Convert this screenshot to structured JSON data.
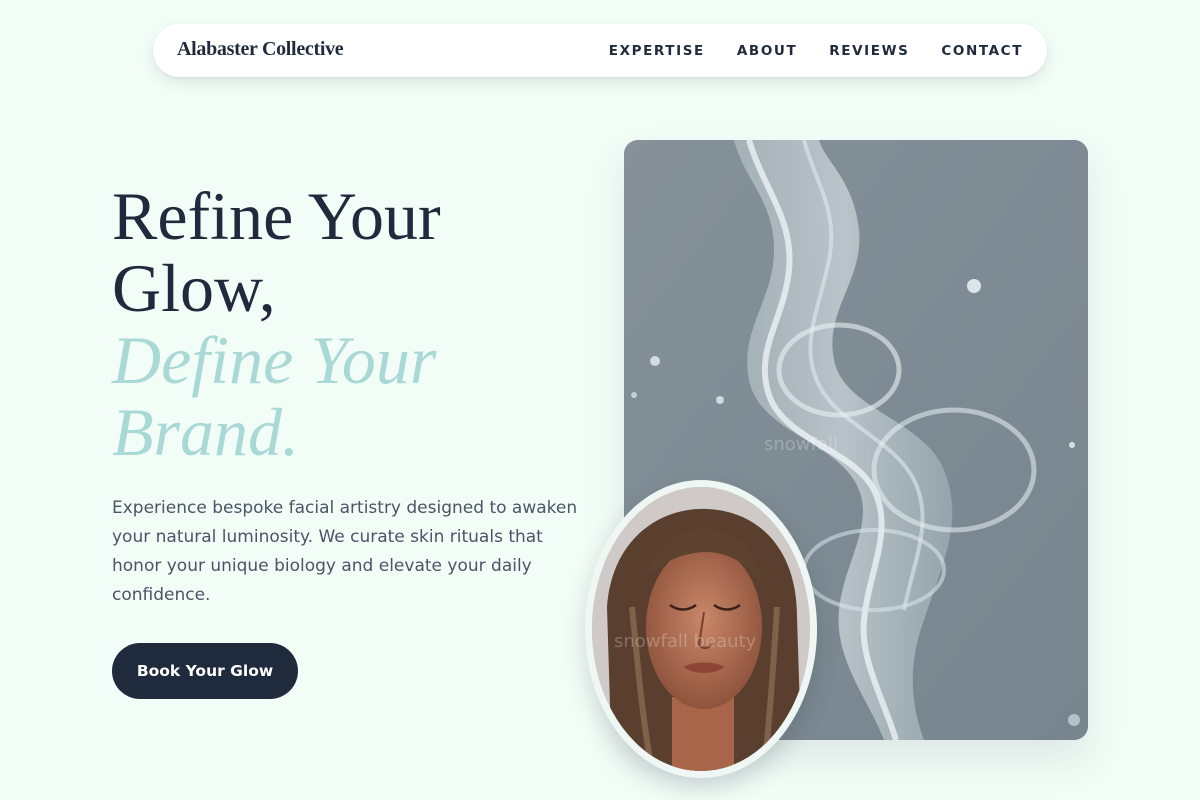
{
  "nav": {
    "brand": "Alabaster Collective",
    "links": [
      {
        "label": "EXPERTISE"
      },
      {
        "label": "ABOUT"
      },
      {
        "label": "REVIEWS"
      },
      {
        "label": "CONTACT"
      }
    ]
  },
  "hero": {
    "headline_line1": "Refine Your",
    "headline_line2": "Glow,",
    "headline_accent1": "Define Your",
    "headline_accent2": "Brand.",
    "description": "Experience bespoke facial artistry designed to awaken your natural luminosity. We curate skin rituals that honor your unique biology and elevate your daily confidence.",
    "cta_label": "Book Your Glow"
  },
  "images": {
    "water_watermark": "snowfall",
    "portrait_watermark": "snowfall beauty"
  },
  "colors": {
    "background": "#f3fdf8",
    "primary": "#1f2a3d",
    "accent": "#a9d9d4",
    "body_text": "#4a5566",
    "image_backdrop": "#7e8d97"
  }
}
